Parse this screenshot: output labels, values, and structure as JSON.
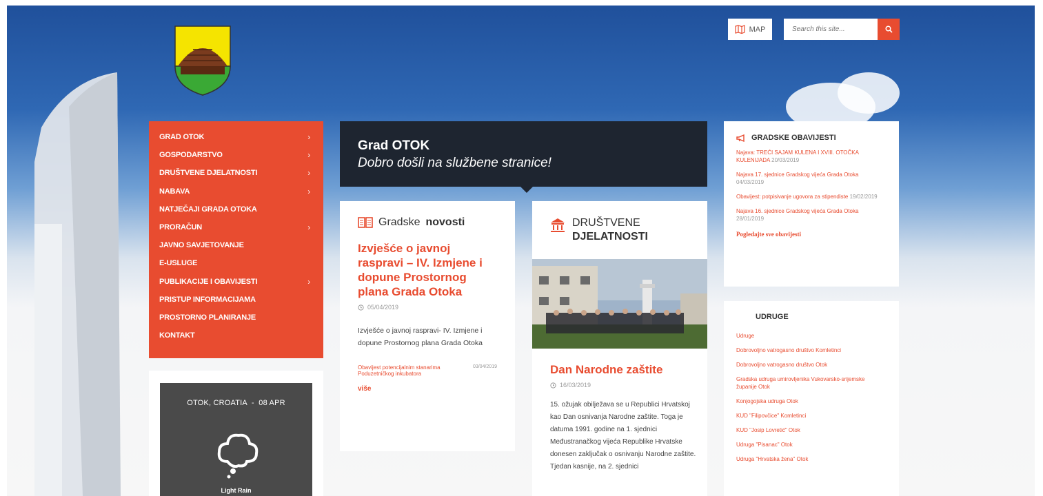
{
  "header": {
    "map_label": "MAP",
    "search_placeholder": "Search this site..."
  },
  "nav": {
    "items": [
      {
        "label": "GRAD OTOK",
        "chev": "›"
      },
      {
        "label": "GOSPODARSTVO",
        "chev": "›"
      },
      {
        "label": "DRUŠTVENE DJELATNOSTI",
        "chev": "›"
      },
      {
        "label": "NABAVA",
        "chev": "›"
      },
      {
        "label": "NATJEČAJI GRADA OTOKA",
        "chev": ""
      },
      {
        "label": "PRORAČUN",
        "chev": "›"
      },
      {
        "label": "JAVNO SAVJETOVANJE",
        "chev": ""
      },
      {
        "label": "E-USLUGE",
        "chev": ""
      },
      {
        "label": "PUBLIKACIJE I OBAVIJESTI",
        "chev": "›"
      },
      {
        "label": "PRISTUP INFORMACIJAMA",
        "chev": ""
      },
      {
        "label": "PROSTORNO PLANIRANJE",
        "chev": ""
      },
      {
        "label": "KONTAKT",
        "chev": ""
      }
    ]
  },
  "weather": {
    "location": "OTOK, CROATIA",
    "separator": "-",
    "date": "08 APR",
    "description": "Light Rain"
  },
  "banner": {
    "title": "Grad OTOK",
    "subtitle": "Dobro došli na službene stranice!"
  },
  "news": {
    "heading_normal": "Gradske",
    "heading_bold": "novosti",
    "title": "Izvješće o javnoj raspravi – IV. Izmjene i dopune Prostornog plana Grada Otoka",
    "date": "05/04/2019",
    "excerpt": "Izvješće o javnoj raspravi- IV. Izmjene i dopune Prostornog plana Grada Otoka",
    "secondary_title": "Obavijest potencijalnim stanarima Poduzetničkog inkubatora",
    "secondary_date": "03/04/2019",
    "more": "više"
  },
  "djelatnosti": {
    "heading_line1": "DRUŠTVENE",
    "heading_line2": "DJELATNOSTI",
    "title": "Dan Narodne zaštite",
    "date": "16/03/2019",
    "excerpt": "15. ožujak obilježava se u Republici Hrvatskoj kao Dan osnivanja Narodne zaštite. Toga je datuma 1991. godine na 1. sjednici Međustranačkog vijeća Republike Hrvatske donesen zaključak o osnivanju Narodne zaštite. Tjedan kasnije, na 2. sjednici"
  },
  "obavijesti": {
    "title": "GRADSKE OBAVIJESTI",
    "items": [
      {
        "text": "Najava: TREĆI SAJAM KULENA I XVIII. OTOČKA KULENIJADA",
        "date": "20/03/2019"
      },
      {
        "text": "Najava 17. sjednice Gradskog vijeća Grada Otoka",
        "date": "04/03/2019"
      },
      {
        "text": "Obavijest: potpisivanje ugovora za stipendiste",
        "date": "19/02/2019"
      },
      {
        "text": "Najava 16. sjednice Gradskog vijeća Grada Otoka",
        "date": "28/01/2019"
      }
    ],
    "all_link": "Pogledajte sve obavijesti"
  },
  "udruge": {
    "title": "UDRUGE",
    "items": [
      "Udruge",
      "Dobrovoljno vatrogasno društvo Komletinci",
      "Dobrovoljno vatrogasno društvo Otok",
      "Gradska udruga umirovljenika Vukovarsko-srijemske županije Otok",
      "Konjogojska udruga Otok",
      "KUD \"Filipovčice\" Komletinci",
      "KUD \"Josip Lovretić\" Otok",
      "Udruga \"Pisanac\" Otok",
      "Udruga \"Hrvatska žena\" Otok"
    ]
  },
  "colors": {
    "accent": "#e84c30",
    "dark": "#1e2530",
    "weather_bg": "#4a4a4a"
  }
}
